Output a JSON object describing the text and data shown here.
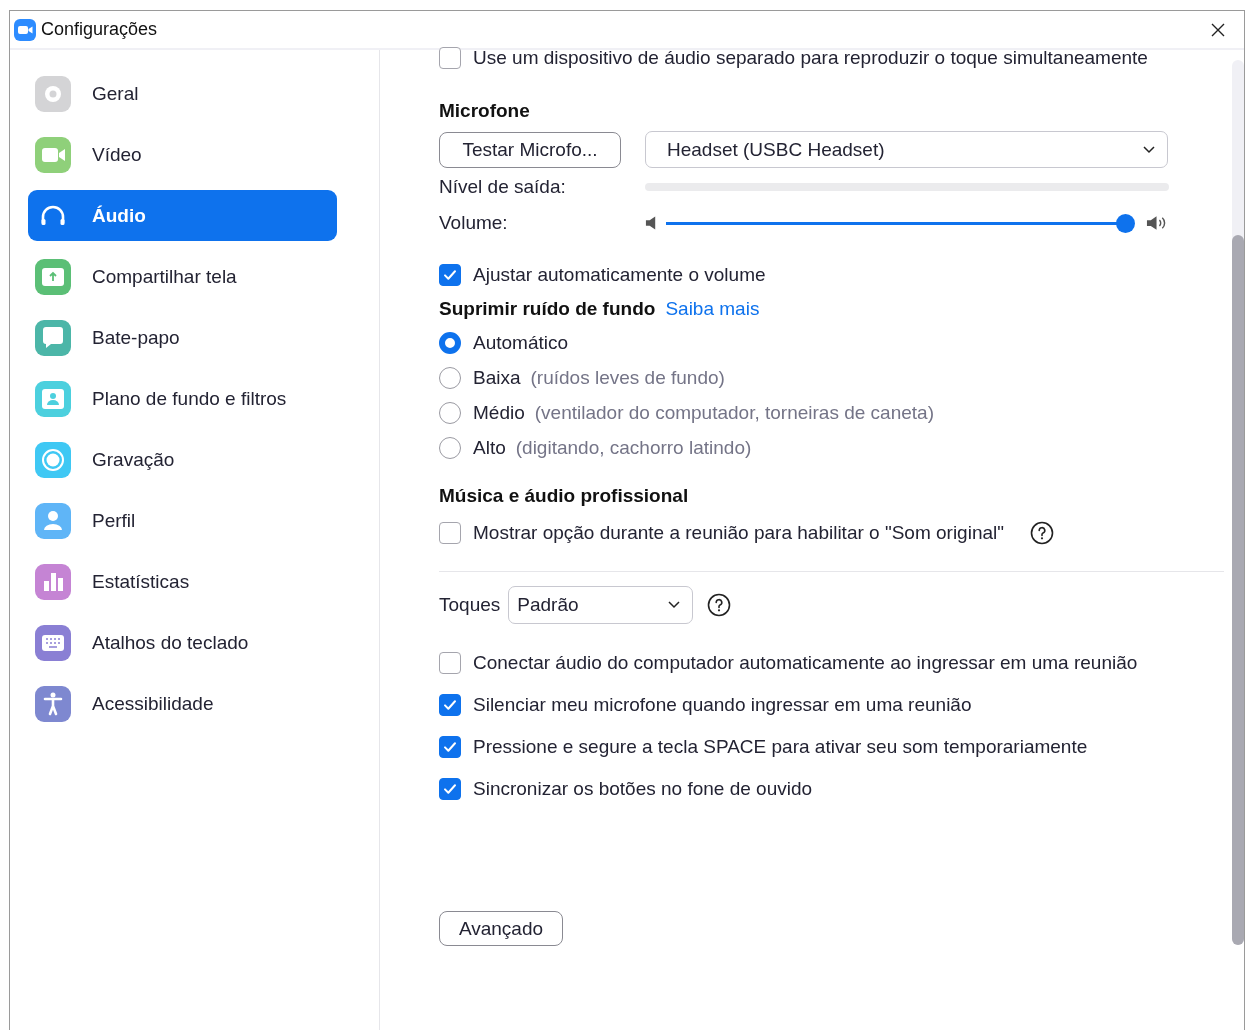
{
  "window": {
    "title": "Configurações"
  },
  "sidebar": {
    "items": [
      {
        "label": "Geral",
        "selected": false
      },
      {
        "label": "Vídeo",
        "selected": false
      },
      {
        "label": "Áudio",
        "selected": true
      },
      {
        "label": "Compartilhar tela",
        "selected": false
      },
      {
        "label": "Bate-papo",
        "selected": false
      },
      {
        "label": "Plano de fundo e filtros",
        "selected": false
      },
      {
        "label": "Gravação",
        "selected": false
      },
      {
        "label": "Perfil",
        "selected": false
      },
      {
        "label": "Estatísticas",
        "selected": false
      },
      {
        "label": "Atalhos do teclado",
        "selected": false
      },
      {
        "label": "Acessibilidade",
        "selected": false
      }
    ]
  },
  "separate_device": {
    "label": "Use um dispositivo de áudio separado para reproduzir o toque simultaneamente",
    "checked": false
  },
  "microphone": {
    "heading": "Microfone",
    "test_button": "Testar Microfo...",
    "device": "Headset (USBC Headset)",
    "output_level_label": "Nível de saída:",
    "output_level": {
      "level": 0
    },
    "volume_label": "Volume:",
    "volume": {
      "level": 1
    }
  },
  "auto_adjust": {
    "label": "Ajustar automaticamente o volume",
    "checked": true
  },
  "noise_suppression": {
    "heading": "Suprimir ruído de fundo",
    "link": "Saiba mais",
    "options": [
      {
        "label": "Automático",
        "selected": true
      },
      {
        "label": "Baixa",
        "hint": "(ruídos leves de fundo)",
        "selected": false
      },
      {
        "label": "Médio",
        "hint": "(ventilador do computador, torneiras de caneta)",
        "selected": false
      },
      {
        "label": "Alto",
        "hint": "(digitando, cachorro latindo)",
        "selected": false
      }
    ]
  },
  "music": {
    "heading": "Música e áudio profissional",
    "option": {
      "label": "Mostrar opção durante a reunião para habilitar o \"Som original\"",
      "checked": false
    }
  },
  "ringtones": {
    "label": "Toques",
    "value": "Padrão"
  },
  "options": [
    {
      "label": "Conectar áudio do computador automaticamente ao ingressar em uma reunião",
      "checked": false
    },
    {
      "label": "Silenciar meu microfone quando ingressar em uma reunião",
      "checked": true
    },
    {
      "label": "Pressione e segure a tecla SPACE para ativar seu som temporariamente",
      "checked": true
    },
    {
      "label": "Sincronizar os botões no fone de ouvido",
      "checked": true
    }
  ],
  "advanced_button": "Avançado"
}
